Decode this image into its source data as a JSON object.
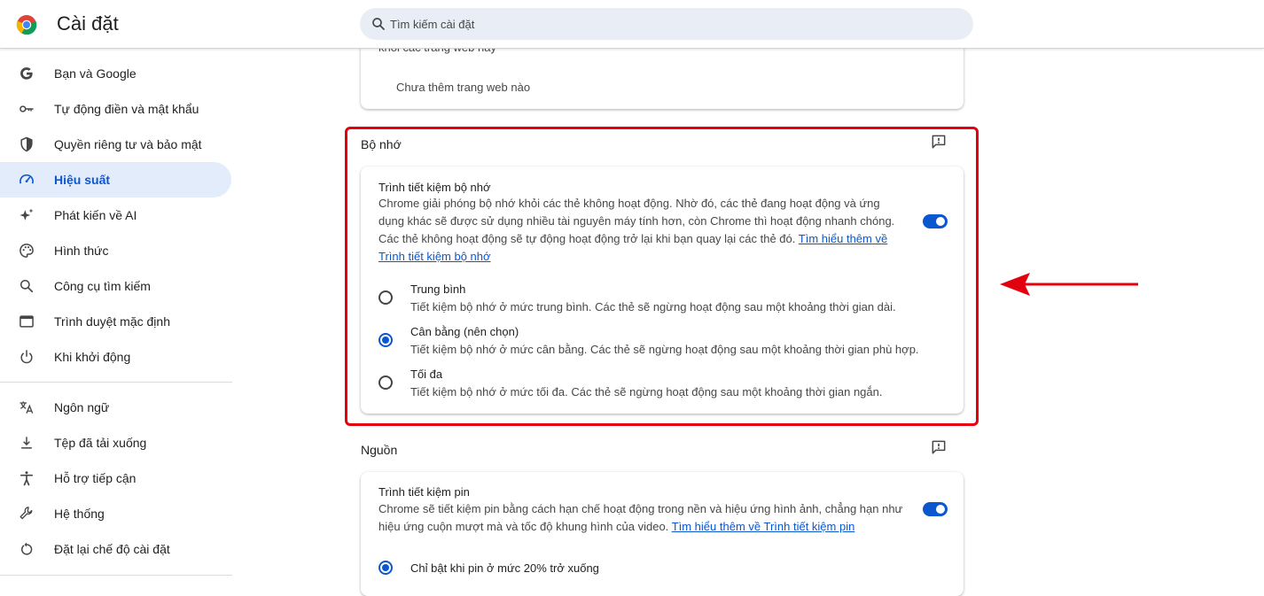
{
  "header": {
    "title": "Cài đặt",
    "search_placeholder": "Tìm kiếm cài đặt"
  },
  "sidebar": {
    "items": [
      {
        "label": "Bạn và Google",
        "icon": "google-g-icon"
      },
      {
        "label": "Tự động điền và mật khẩu",
        "icon": "key-icon"
      },
      {
        "label": "Quyền riêng tư và bảo mật",
        "icon": "shield-icon"
      },
      {
        "label": "Hiệu suất",
        "icon": "speedometer-icon",
        "active": true
      },
      {
        "label": "Phát kiến về AI",
        "icon": "sparkle-icon"
      },
      {
        "label": "Hình thức",
        "icon": "palette-icon"
      },
      {
        "label": "Công cụ tìm kiếm",
        "icon": "search-icon"
      },
      {
        "label": "Trình duyệt mặc định",
        "icon": "browser-window-icon"
      },
      {
        "label": "Khi khởi động",
        "icon": "power-icon"
      },
      {
        "label": "Ngôn ngữ",
        "icon": "translate-icon"
      },
      {
        "label": "Tệp đã tải xuống",
        "icon": "download-icon"
      },
      {
        "label": "Hỗ trợ tiếp cận",
        "icon": "accessibility-icon"
      },
      {
        "label": "Hệ thống",
        "icon": "wrench-icon"
      },
      {
        "label": "Đặt lại chế độ cài đặt",
        "icon": "reset-icon"
      }
    ]
  },
  "top_card": {
    "cut_text": "khỏi các trang web này",
    "empty_text": "Chưa thêm trang web nào"
  },
  "memory_section": {
    "title": "Bộ nhớ",
    "setting_title": "Trình tiết kiệm bộ nhớ",
    "desc_line1": "Chrome giải phóng bộ nhớ khỏi các thẻ không hoạt động. Nhờ đó, các thẻ đang hoạt động và ứng",
    "desc_line2": "dụng khác sẽ được sử dụng nhiều tài nguyên máy tính hơn, còn Chrome thì hoạt động nhanh chóng.",
    "desc_line3": "Các thẻ không hoạt động sẽ tự động hoạt động trở lại khi bạn quay lại các thẻ đó.",
    "learn_more_1": "Tìm hiểu thêm về",
    "learn_more_2": "Trình tiết kiệm bộ nhớ",
    "toggle_on": true,
    "options": [
      {
        "title": "Trung bình",
        "desc": "Tiết kiệm bộ nhớ ở mức trung bình. Các thẻ sẽ ngừng hoạt động sau một khoảng thời gian dài.",
        "checked": false
      },
      {
        "title": "Cân bằng (nên chọn)",
        "desc": "Tiết kiệm bộ nhớ ở mức cân bằng. Các thẻ sẽ ngừng hoạt động sau một khoảng thời gian phù hợp.",
        "checked": true
      },
      {
        "title": "Tối đa",
        "desc": "Tiết kiệm bộ nhớ ở mức tối đa. Các thẻ sẽ ngừng hoạt động sau một khoảng thời gian ngắn.",
        "checked": false
      }
    ]
  },
  "power_section": {
    "title": "Nguồn",
    "setting_title": "Trình tiết kiệm pin",
    "desc_line1": "Chrome sẽ tiết kiệm pin bằng cách hạn chế hoạt động trong nền và hiệu ứng hình ảnh, chẳng hạn như",
    "desc_line2": "hiệu ứng cuộn mượt mà và tốc độ khung hình của video.",
    "learn_more": "Tìm hiểu thêm về Trình tiết kiệm pin",
    "toggle_on": true,
    "option_label": "Chỉ bật khi pin ở mức 20% trở xuống"
  },
  "colors": {
    "accent": "#0b57d0",
    "highlight": "#e2000f",
    "active_nav_bg": "#e3ecfb"
  }
}
